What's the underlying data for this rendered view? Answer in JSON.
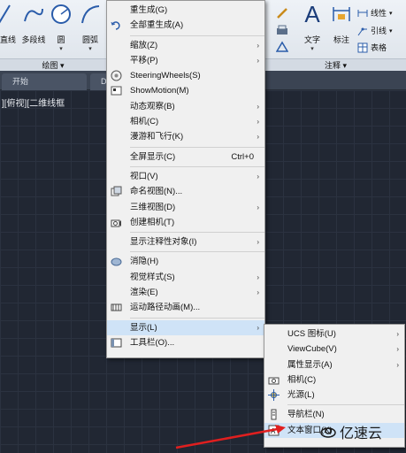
{
  "ribbon": {
    "tools_left": [
      {
        "label": "直线"
      },
      {
        "label": "多段线"
      },
      {
        "label": "圆"
      },
      {
        "label": "圆弧"
      }
    ],
    "panel_draw": "绘图 ▾",
    "text_tool": "文字",
    "dim_tool": "标注",
    "small_tools": {
      "linear": "线性",
      "leader": "引线",
      "table": "表格"
    },
    "panel_annotation": "注释 ▾"
  },
  "tabs": {
    "start": "开始",
    "doc": "Dr"
  },
  "viewport_label": "][俯视][二维线框",
  "main_menu": {
    "items": [
      {
        "label": "重生成(G)",
        "icon": "",
        "arrow": false
      },
      {
        "label": "全部重生成(A)",
        "icon": "regen-all-icon",
        "arrow": false
      },
      {
        "sep": true
      },
      {
        "label": "缩放(Z)",
        "arrow": true
      },
      {
        "label": "平移(P)",
        "arrow": true
      },
      {
        "label": "SteeringWheels(S)",
        "icon": "steering-wheel-icon"
      },
      {
        "label": "ShowMotion(M)",
        "icon": "showmotion-icon"
      },
      {
        "label": "动态观察(B)",
        "arrow": true
      },
      {
        "label": "相机(C)",
        "arrow": true
      },
      {
        "label": "漫游和飞行(K)",
        "arrow": true
      },
      {
        "sep": true
      },
      {
        "label": "全屏显示(C)",
        "shortcut": "Ctrl+0"
      },
      {
        "sep": true
      },
      {
        "label": "视口(V)",
        "arrow": true
      },
      {
        "label": "命名视图(N)...",
        "icon": "named-view-icon"
      },
      {
        "label": "三维视图(D)",
        "arrow": true
      },
      {
        "label": "创建相机(T)",
        "icon": "create-camera-icon"
      },
      {
        "sep": true
      },
      {
        "label": "显示注释性对象(I)",
        "arrow": true
      },
      {
        "sep": true
      },
      {
        "label": "消隐(H)",
        "icon": "hide-icon"
      },
      {
        "label": "视觉样式(S)",
        "arrow": true
      },
      {
        "label": "渲染(E)",
        "arrow": true
      },
      {
        "label": "运动路径动画(M)...",
        "icon": "motion-path-icon"
      },
      {
        "sep": true
      },
      {
        "label": "显示(L)",
        "arrow": true,
        "highlight": true
      },
      {
        "label": "工具栏(O)...",
        "icon": "toolbar-icon"
      }
    ]
  },
  "sub_menu": {
    "items": [
      {
        "label": "UCS 图标(U)",
        "arrow": true
      },
      {
        "label": "ViewCube(V)",
        "arrow": true
      },
      {
        "label": "属性显示(A)",
        "arrow": true
      },
      {
        "label": "相机(C)",
        "icon": "camera-icon"
      },
      {
        "label": "光源(L)",
        "icon": "light-icon"
      },
      {
        "sep": true
      },
      {
        "label": "导航栏(N)",
        "icon": "nav-bar-icon"
      },
      {
        "label": "文本窗口(X)",
        "icon": "text-window-icon",
        "highlight": true
      }
    ]
  },
  "watermark": "亿速云",
  "colors": {
    "highlight": "#cfe3f7",
    "arrow": "#e01f1f",
    "menu_bg": "#f0f0f0"
  }
}
